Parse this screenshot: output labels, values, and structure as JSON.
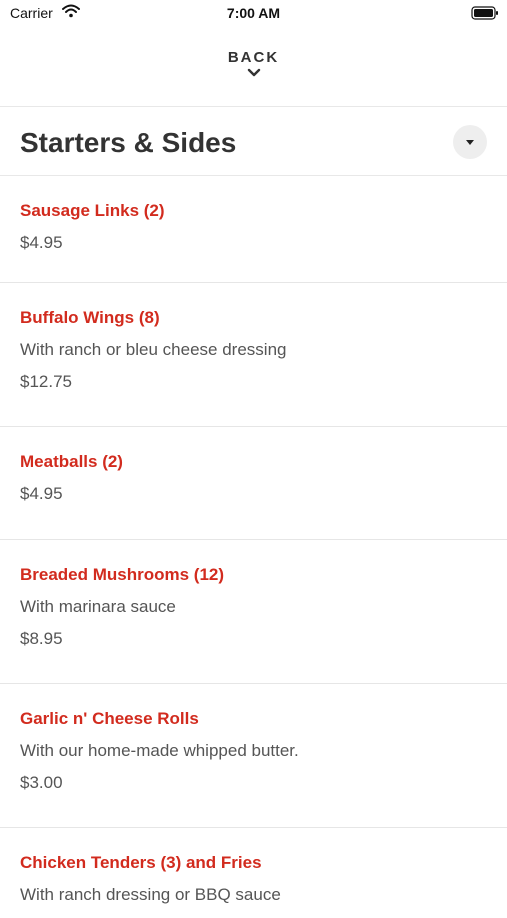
{
  "status_bar": {
    "carrier": "Carrier",
    "time": "7:00 AM"
  },
  "nav": {
    "back_label": "BACK"
  },
  "section": {
    "title": "Starters & Sides"
  },
  "menu_items": [
    {
      "name": "Sausage Links (2)",
      "description": "",
      "price": "$4.95"
    },
    {
      "name": "Buffalo Wings (8)",
      "description": "With ranch or bleu cheese dressing",
      "price": "$12.75"
    },
    {
      "name": "Meatballs (2)",
      "description": "",
      "price": "$4.95"
    },
    {
      "name": "Breaded Mushrooms (12)",
      "description": "With marinara sauce",
      "price": "$8.95"
    },
    {
      "name": "Garlic n' Cheese Rolls",
      "description": "With our home-made whipped butter.",
      "price": "$3.00"
    },
    {
      "name": "Chicken Tenders (3) and Fries",
      "description": "With ranch dressing or BBQ sauce",
      "price": ""
    }
  ],
  "colors": {
    "accent": "#d22b1e",
    "text_secondary": "#555555",
    "divider": "#e8e8e8"
  },
  "icons": {
    "wifi": "wifi-icon",
    "battery": "battery-icon",
    "back_chevron": "chevron-down-icon",
    "dropdown": "caret-down-icon"
  }
}
